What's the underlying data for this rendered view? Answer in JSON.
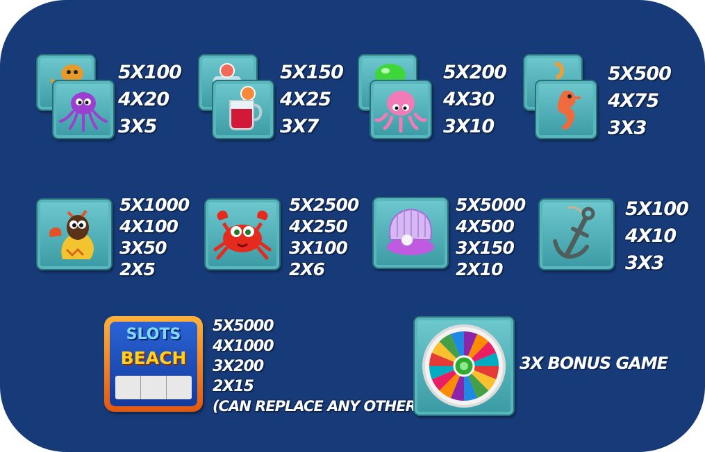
{
  "symbols": [
    {
      "name": "jellyfish",
      "pays": [
        "5X100",
        "4X20",
        "3X5"
      ]
    },
    {
      "name": "juice",
      "pays": [
        "5X150",
        "4X25",
        "3X7"
      ]
    },
    {
      "name": "octopus",
      "pays": [
        "5X200",
        "4X30",
        "3X10"
      ]
    },
    {
      "name": "seahorse",
      "pays": [
        "5X500",
        "4X75",
        "3X3"
      ]
    },
    {
      "name": "hermit-crab",
      "pays": [
        "5X1000",
        "4X100",
        "3X50",
        "2X5"
      ]
    },
    {
      "name": "crab",
      "pays": [
        "5X2500",
        "4X250",
        "3X100",
        "2X6"
      ]
    },
    {
      "name": "pearl",
      "pays": [
        "5X5000",
        "4X500",
        "3X150",
        "2X10"
      ]
    },
    {
      "name": "anchor",
      "pays": [
        "5X100",
        "4X10",
        "3X3"
      ]
    }
  ],
  "wild": {
    "logo_line1": "SLOTS",
    "logo_line2": "BEACH",
    "pays": [
      "5X5000",
      "4X1000",
      "3X200",
      "2X15"
    ],
    "note": "(CAN REPLACE ANY OTHER)"
  },
  "bonus": {
    "label": "3X BONUS GAME"
  },
  "colors": {
    "background": "#173b78",
    "tile": "#58b6bd",
    "text": "#ffffff"
  }
}
